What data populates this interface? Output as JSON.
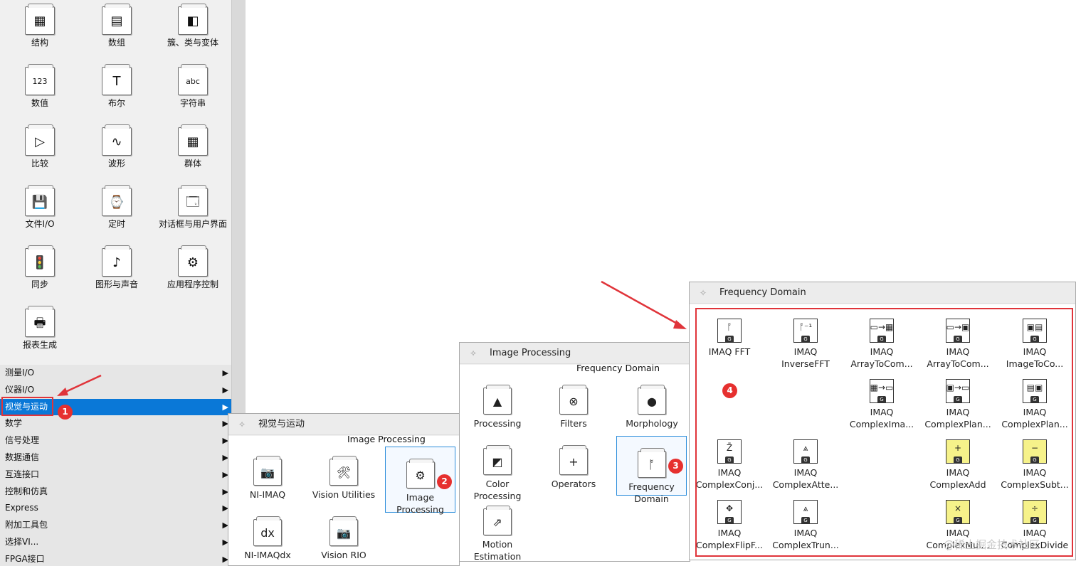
{
  "palette": {
    "icons": [
      {
        "label": "结构",
        "glyph": "▦",
        "name": "structures-icon"
      },
      {
        "label": "数组",
        "glyph": "▤",
        "name": "array-icon"
      },
      {
        "label": "簇、类与变体",
        "glyph": "◧",
        "name": "cluster-class-variant-icon"
      },
      {
        "label": "数值",
        "glyph": "123",
        "name": "numeric-icon"
      },
      {
        "label": "布尔",
        "glyph": "T",
        "name": "boolean-icon"
      },
      {
        "label": "字符串",
        "glyph": "abc",
        "name": "string-icon"
      },
      {
        "label": "比较",
        "glyph": "▷",
        "name": "comparison-icon"
      },
      {
        "label": "波形",
        "glyph": "∿",
        "name": "waveform-icon"
      },
      {
        "label": "群体",
        "glyph": "▦",
        "name": "collection-icon"
      },
      {
        "label": "文件I/O",
        "glyph": "💾",
        "name": "file-io-icon"
      },
      {
        "label": "定时",
        "glyph": "⌚",
        "name": "timing-icon"
      },
      {
        "label": "对话框与用户界面",
        "glyph": "🗔",
        "name": "dialog-ui-icon"
      },
      {
        "label": "同步",
        "glyph": "🚦",
        "name": "synchronization-icon"
      },
      {
        "label": "图形与声音",
        "glyph": "♪",
        "name": "graphics-sound-icon"
      },
      {
        "label": "应用程序控制",
        "glyph": "⚙",
        "name": "app-control-icon"
      },
      {
        "label": "报表生成",
        "glyph": "🖶",
        "name": "report-generation-icon"
      }
    ],
    "menu": [
      {
        "label": "测量I/O",
        "selected": false
      },
      {
        "label": "仪器I/O",
        "selected": false
      },
      {
        "label": "视觉与运动",
        "selected": true
      },
      {
        "label": "数学",
        "selected": false
      },
      {
        "label": "信号处理",
        "selected": false
      },
      {
        "label": "数据通信",
        "selected": false
      },
      {
        "label": "互连接口",
        "selected": false
      },
      {
        "label": "控制和仿真",
        "selected": false
      },
      {
        "label": "Express",
        "selected": false
      },
      {
        "label": "附加工具包",
        "selected": false
      },
      {
        "label": "选择VI...",
        "selected": false
      },
      {
        "label": "FPGA接口",
        "selected": false
      }
    ],
    "submenu_arrow": "▶"
  },
  "vision_window": {
    "title": "视觉与运动",
    "subtitle": "Image Processing",
    "tiles": [
      {
        "label": "NI-IMAQ",
        "glyph": "📷",
        "name": "ni-imaq-icon"
      },
      {
        "label": "Vision Utilities",
        "glyph": "🛠",
        "name": "vision-utilities-icon"
      },
      {
        "label": "Image Processing",
        "glyph": "⚙",
        "name": "image-processing-icon"
      },
      {
        "label": "NI-IMAQdx",
        "glyph": "dx",
        "name": "ni-imaqdx-icon"
      },
      {
        "label": "Vision RIO",
        "glyph": "📷",
        "name": "vision-rio-icon"
      }
    ]
  },
  "image_processing_window": {
    "title": "Image Processing",
    "subtitle": "Frequency Domain",
    "tiles": [
      {
        "label": "Processing",
        "glyph": "▲",
        "name": "processing-icon"
      },
      {
        "label": "Filters",
        "glyph": "⊗",
        "name": "filters-icon"
      },
      {
        "label": "Morphology",
        "glyph": "●",
        "name": "morphology-icon"
      },
      {
        "label": "Color Processing",
        "glyph": "◩",
        "name": "color-processing-icon"
      },
      {
        "label": "Operators",
        "glyph": "+",
        "name": "operators-icon"
      },
      {
        "label": "Frequency Domain",
        "glyph": "ᚩ",
        "name": "frequency-domain-icon"
      },
      {
        "label": "Motion Estimation",
        "glyph": "⇗",
        "name": "motion-estimation-icon"
      }
    ]
  },
  "frequency_window": {
    "title": "Frequency Domain",
    "vis": [
      {
        "line1": "IMAQ",
        "line2": "FFT",
        "glyph": "ᚩ",
        "yellow": false,
        "name": "imaq-fft-icon",
        "one_line": true
      },
      {
        "line1": "IMAQ",
        "line2": "InverseFFT",
        "glyph": "ᚩ⁻¹",
        "yellow": false,
        "name": "imaq-inverse-fft-icon"
      },
      {
        "line1": "IMAQ",
        "line2": "ArrayToCom...",
        "glyph": "▭→▦",
        "yellow": false,
        "name": "imaq-array-to-complex-image-icon"
      },
      {
        "line1": "IMAQ",
        "line2": "ArrayToCom...",
        "glyph": "▭→▣",
        "yellow": false,
        "name": "imaq-array-to-complex-plane-icon"
      },
      {
        "line1": "IMAQ",
        "line2": "ImageToCo...",
        "glyph": "▣▤",
        "yellow": false,
        "name": "imaq-image-to-complex-plane-icon"
      },
      {
        "line1": "IMAQ",
        "line2": "ComplexIma...",
        "glyph": "▦→▭",
        "yellow": false,
        "name": "imaq-complex-image-to-array-icon"
      },
      {
        "line1": "IMAQ",
        "line2": "ComplexPlan...",
        "glyph": "▣→▭",
        "yellow": false,
        "name": "imaq-complex-plane-to-array-icon"
      },
      {
        "line1": "IMAQ",
        "line2": "ComplexPlan...",
        "glyph": "▤▣",
        "yellow": false,
        "name": "imaq-complex-plane-to-image-icon"
      },
      {
        "line1": "IMAQ",
        "line2": "ComplexConj...",
        "glyph": "Z̄",
        "yellow": false,
        "name": "imaq-complex-conjugate-icon"
      },
      {
        "line1": "IMAQ",
        "line2": "ComplexAtte...",
        "glyph": "⩓",
        "yellow": false,
        "name": "imaq-complex-attenuate-icon"
      },
      {
        "line1": "IMAQ",
        "line2": "ComplexAdd",
        "glyph": "+",
        "yellow": true,
        "name": "imaq-complex-add-icon"
      },
      {
        "line1": "IMAQ",
        "line2": "ComplexSubt...",
        "glyph": "−",
        "yellow": true,
        "name": "imaq-complex-subtract-icon"
      },
      {
        "line1": "IMAQ",
        "line2": "ComplexFlipF...",
        "glyph": "✥",
        "yellow": false,
        "name": "imaq-complex-flip-frequency-icon"
      },
      {
        "line1": "IMAQ",
        "line2": "ComplexTrun...",
        "glyph": "⩓",
        "yellow": false,
        "name": "imaq-complex-truncate-icon"
      },
      {
        "line1": "IMAQ",
        "line2": "ComplexMul...",
        "glyph": "×",
        "yellow": true,
        "name": "imaq-complex-multiply-icon"
      },
      {
        "line1": "IMAQ",
        "line2": "ComplexDivide",
        "glyph": "÷",
        "yellow": true,
        "name": "imaq-complex-divide-icon"
      }
    ],
    "vi_tag": "G"
  },
  "annotations": {
    "badges": [
      "1",
      "2",
      "3",
      "4"
    ],
    "accent": "#e0343a",
    "selection": "#0a78d7"
  },
  "watermark": "@稀土掘金技术社区"
}
